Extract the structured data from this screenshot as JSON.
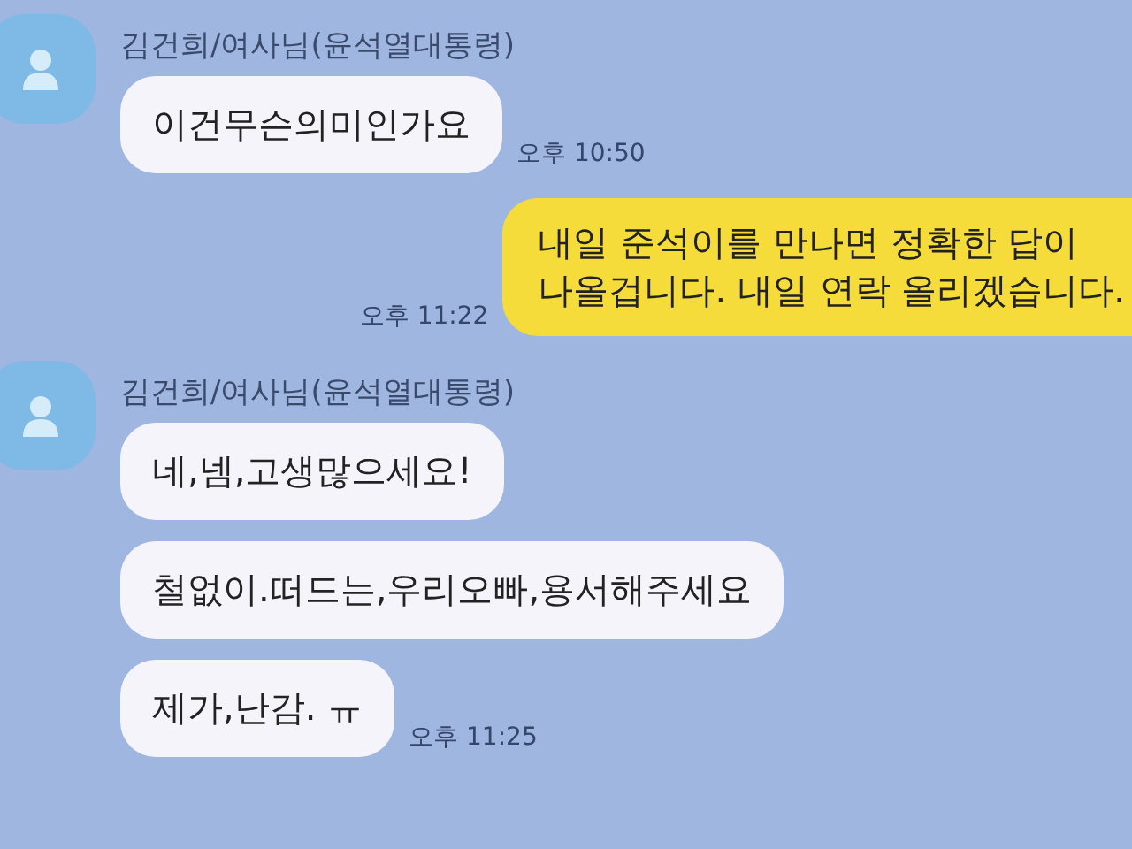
{
  "groups": [
    {
      "kind": "received",
      "sender": "김건희/여사님(윤석열대통령)",
      "messages": [
        "이건무슨의미인가요"
      ],
      "time": "오후 10:50"
    },
    {
      "kind": "sent",
      "messages": [
        "내일 준석이를 만나면 정확한 답이\n나올겁니다. 내일 연락 올리겠습니다."
      ],
      "time": "오후 11:22"
    },
    {
      "kind": "received",
      "sender": "김건희/여사님(윤석열대통령)",
      "messages": [
        "네,넴,고생많으세요!",
        "철없이.떠드는,우리오빠,용서해주세요",
        "제가,난감. ㅠ"
      ],
      "time": "오후 11:25"
    }
  ]
}
